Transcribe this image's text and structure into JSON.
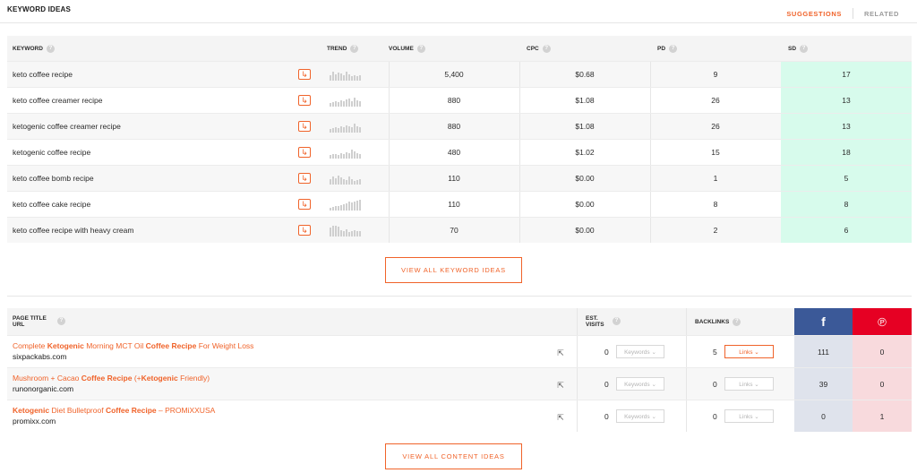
{
  "header": {
    "title": "KEYWORD IDEAS",
    "tabs": [
      {
        "label": "SUGGESTIONS",
        "active": true
      },
      {
        "label": "RELATED",
        "active": false
      }
    ]
  },
  "keyword_table": {
    "columns": {
      "keyword": "KEYWORD",
      "trend": "TREND",
      "volume": "VOLUME",
      "cpc": "CPC",
      "pd": "PD",
      "sd": "SD"
    },
    "rows": [
      {
        "keyword": "keto coffee recipe",
        "volume": "5,400",
        "cpc": "$0.68",
        "pd": "9",
        "sd": "17"
      },
      {
        "keyword": "keto coffee creamer recipe",
        "volume": "880",
        "cpc": "$1.08",
        "pd": "26",
        "sd": "13"
      },
      {
        "keyword": "ketogenic coffee creamer recipe",
        "volume": "880",
        "cpc": "$1.08",
        "pd": "26",
        "sd": "13"
      },
      {
        "keyword": "ketogenic coffee recipe",
        "volume": "480",
        "cpc": "$1.02",
        "pd": "15",
        "sd": "18"
      },
      {
        "keyword": "keto coffee bomb recipe",
        "volume": "110",
        "cpc": "$0.00",
        "pd": "1",
        "sd": "5"
      },
      {
        "keyword": "keto coffee cake recipe",
        "volume": "110",
        "cpc": "$0.00",
        "pd": "8",
        "sd": "8"
      },
      {
        "keyword": "keto coffee recipe with heavy cream",
        "volume": "70",
        "cpc": "$0.00",
        "pd": "2",
        "sd": "6"
      }
    ],
    "colors": {
      "sd_background": "#d7fbec",
      "accent": "#f0632a"
    },
    "row_icon": "arrow-right-icon"
  },
  "view_all_keywords": "VIEW ALL KEYWORD IDEAS",
  "content_table": {
    "columns": {
      "page_title": "PAGE TITLE",
      "url": "URL",
      "est": "EST.",
      "visits": "VISITS",
      "backlinks": "BACKLINKS",
      "facebook": "f",
      "pinterest": "℗"
    },
    "keywords_label": "Keywords ⌄",
    "links_label": "Links ⌄",
    "rows": [
      {
        "title_parts": [
          {
            "text": "Complete ",
            "bold": false
          },
          {
            "text": "Ketogenic",
            "bold": true
          },
          {
            "text": " Morning MCT Oil ",
            "bold": false
          },
          {
            "text": "Coffee Recipe",
            "bold": true
          },
          {
            "text": " For Weight Loss",
            "bold": false
          }
        ],
        "url": "sixpackabs.com",
        "visits": "0",
        "backlinks": "5",
        "links_active": true,
        "facebook": "111",
        "pinterest": "0"
      },
      {
        "title_parts": [
          {
            "text": "Mushroom + Cacao ",
            "bold": false
          },
          {
            "text": "Coffee Recipe",
            "bold": true
          },
          {
            "text": " (+",
            "bold": false
          },
          {
            "text": "Ketogenic",
            "bold": true
          },
          {
            "text": " Friendly)",
            "bold": false
          }
        ],
        "url": "runonorganic.com",
        "visits": "0",
        "backlinks": "0",
        "links_active": false,
        "facebook": "39",
        "pinterest": "0"
      },
      {
        "title_parts": [
          {
            "text": "Ketogenic",
            "bold": true
          },
          {
            "text": " Diet Bulletproof ",
            "bold": false
          },
          {
            "text": "Coffee Recipe",
            "bold": true
          },
          {
            "text": " – PROMiXXUSA",
            "bold": false
          }
        ],
        "url": "promixx.com",
        "visits": "0",
        "backlinks": "0",
        "links_active": false,
        "facebook": "0",
        "pinterest": "1"
      }
    ],
    "colors": {
      "facebook": "#3b5998",
      "pinterest": "#e60023"
    },
    "row_icon": "external-link-icon"
  },
  "view_all_content": "VIEW ALL CONTENT IDEAS"
}
